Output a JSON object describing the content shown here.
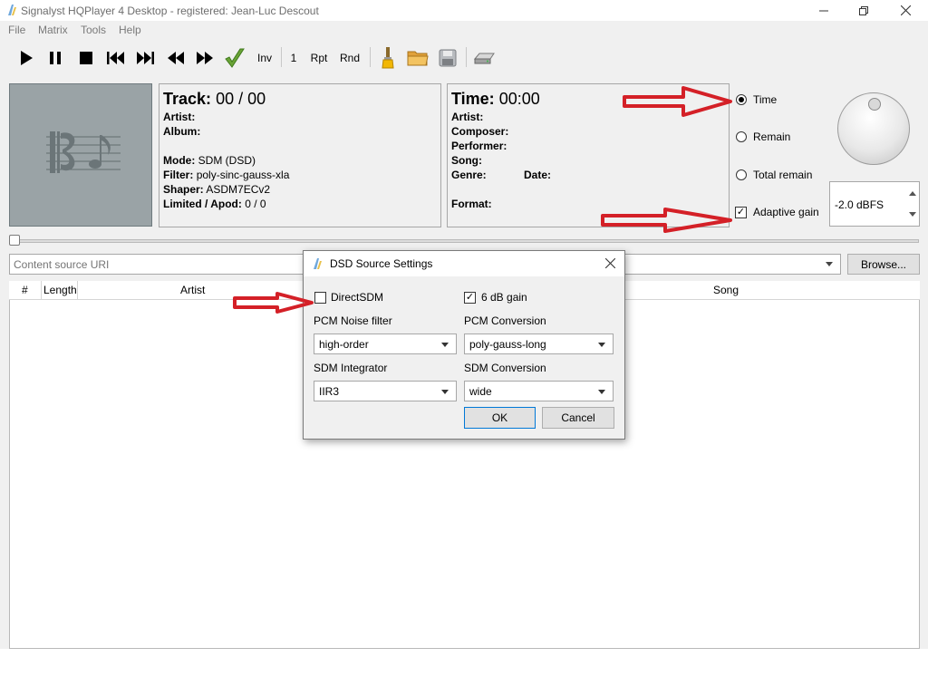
{
  "window": {
    "title": "Signalyst HQPlayer 4 Desktop - registered: Jean-Luc Descout"
  },
  "menu": [
    {
      "label": "File"
    },
    {
      "label": "Matrix"
    },
    {
      "label": "Tools"
    },
    {
      "label": "Help"
    }
  ],
  "toolbar": {
    "inv": "Inv",
    "one": "1",
    "rpt": "Rpt",
    "rnd": "Rnd"
  },
  "track_panel": {
    "track_label": "Track:",
    "track_value": "00 / 00",
    "artist_label": "Artist:",
    "album_label": "Album:",
    "mode_label": "Mode:",
    "mode_value": "SDM (DSD)",
    "filter_label": "Filter:",
    "filter_value": "poly-sinc-gauss-xla",
    "shaper_label": "Shaper:",
    "shaper_value": "ASDM7ECv2",
    "limited_label": "Limited / Apod:",
    "limited_value": "0 / 0"
  },
  "time_panel": {
    "time_label": "Time:",
    "time_value": "00:00",
    "artist_label": "Artist:",
    "composer_label": "Composer:",
    "performer_label": "Performer:",
    "song_label": "Song:",
    "genre_label": "Genre:",
    "date_label": "Date:",
    "format_label": "Format:"
  },
  "display_options": {
    "time": "Time",
    "remain": "Remain",
    "total_remain": "Total remain",
    "selected": "Time"
  },
  "adaptive_gain": {
    "label": "Adaptive gain",
    "checked": true
  },
  "gain": {
    "value": "-2.0 dBFS"
  },
  "source": {
    "placeholder": "Content source URI",
    "browse": "Browse..."
  },
  "playlist": {
    "columns": [
      "#",
      "Length",
      "Artist",
      "Song"
    ]
  },
  "dialog": {
    "title": "DSD Source Settings",
    "direct_sdm_label": "DirectSDM",
    "direct_sdm_checked": false,
    "six_db_label": "6 dB gain",
    "six_db_checked": true,
    "pcm_noise_filter_label": "PCM Noise filter",
    "pcm_noise_filter_value": "high-order",
    "pcm_conversion_label": "PCM Conversion",
    "pcm_conversion_value": "poly-gauss-long",
    "sdm_integrator_label": "SDM Integrator",
    "sdm_integrator_value": "IIR3",
    "sdm_conversion_label": "SDM Conversion",
    "sdm_conversion_value": "wide",
    "ok": "OK",
    "cancel": "Cancel"
  },
  "colors": {
    "annotation_arrow": "#d42027",
    "default_button_border": "#0078d7"
  }
}
